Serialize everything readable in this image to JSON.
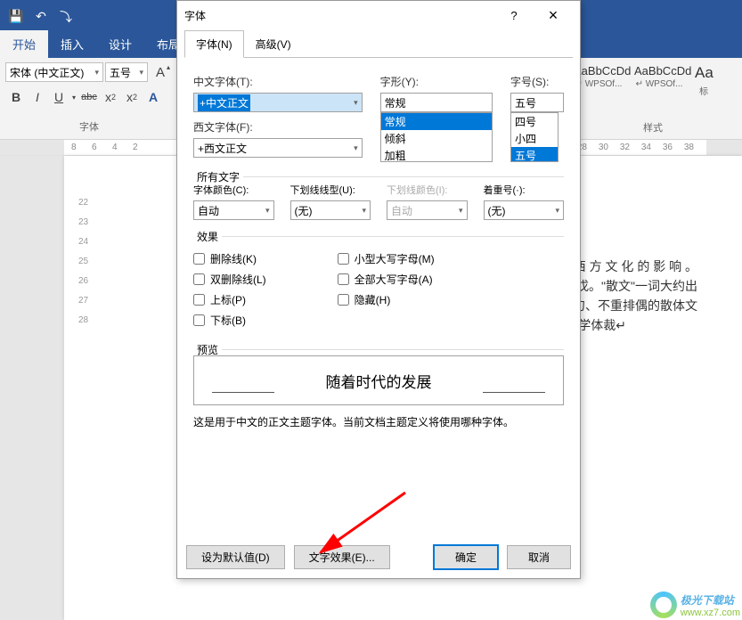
{
  "titlebar": {
    "save_icon": "💾",
    "undo_icon": "↶",
    "cursor_icon": "⤵"
  },
  "tabs": {
    "home": "开始",
    "insert": "插入",
    "design": "设计",
    "layout": "布局"
  },
  "ribbon": {
    "font_name": "宋体 (中文正文)",
    "font_size": "五号",
    "aa_icon": "A",
    "bold": "B",
    "italic": "I",
    "underline": "U",
    "strike": "abc",
    "sub": "x",
    "sub_s": "2",
    "sup": "x",
    "sup_s": "2",
    "clear": "A",
    "group_font": "字体",
    "style1_sample": "AaBbCcDd",
    "style1_name": "↵ WPSOf...",
    "style2_sample": "AaBbCcDd",
    "style2_name": "↵ WPSOf...",
    "style3_sample": "Aa",
    "style3_name": "标",
    "group_styles": "样式"
  },
  "ruler": {
    "t_8": "8",
    "t_6": "6",
    "t_4": "4",
    "t_2": "2",
    "t_22": "22",
    "t_23": "23",
    "t_24": "24",
    "t_25": "25",
    "t_26": "26",
    "t_27": "27",
    "t_28": "28",
    "r_28": "28",
    "r_30": "30",
    "r_32": "32",
    "r_34": "34",
    "r_36": "36",
    "r_38": "38"
  },
  "doc": {
    "l1": "到 西 方 文 化 的 影 响 。",
    "l2": "戊。\"散文\"一词大约出",
    "l3": "勺、不重排偶的散体文",
    "l4": "有文学体裁↵"
  },
  "dialog": {
    "title": "字体",
    "help": "?",
    "close": "×",
    "tab_font": "字体(N)",
    "tab_adv": "高级(V)",
    "cn_font_label": "中文字体(T):",
    "cn_font_value": "+中文正文",
    "en_font_label": "西文字体(F):",
    "en_font_value": "+西文正文",
    "style_label": "字形(Y):",
    "style_value": "常规",
    "style_list": {
      "a": "常规",
      "b": "倾斜",
      "c": "加粗"
    },
    "size_label": "字号(S):",
    "size_value": "五号",
    "size_list": {
      "a": "四号",
      "b": "小四",
      "c": "五号"
    },
    "all_text": "所有文字",
    "font_color": "字体颜色(C):",
    "font_color_v": "自动",
    "ul_style": "下划线线型(U):",
    "ul_style_v": "(无)",
    "ul_color": "下划线颜色(I):",
    "ul_color_v": "自动",
    "emph": "着重号(·):",
    "emph_v": "(无)",
    "effects": "效果",
    "strike": "删除线(K)",
    "dstrike": "双删除线(L)",
    "sup": "上标(P)",
    "sub": "下标(B)",
    "smallcaps": "小型大写字母(M)",
    "allcaps": "全部大写字母(A)",
    "hidden": "隐藏(H)",
    "preview": "预览",
    "preview_text": "随着时代的发展",
    "hint": "这是用于中文的正文主题字体。当前文档主题定义将使用哪种字体。",
    "btn_default": "设为默认值(D)",
    "btn_effects": "文字效果(E)...",
    "btn_ok": "确定",
    "btn_cancel": "取消"
  },
  "watermark": {
    "name": "极光下载站",
    "url": "www.xz7.com"
  }
}
